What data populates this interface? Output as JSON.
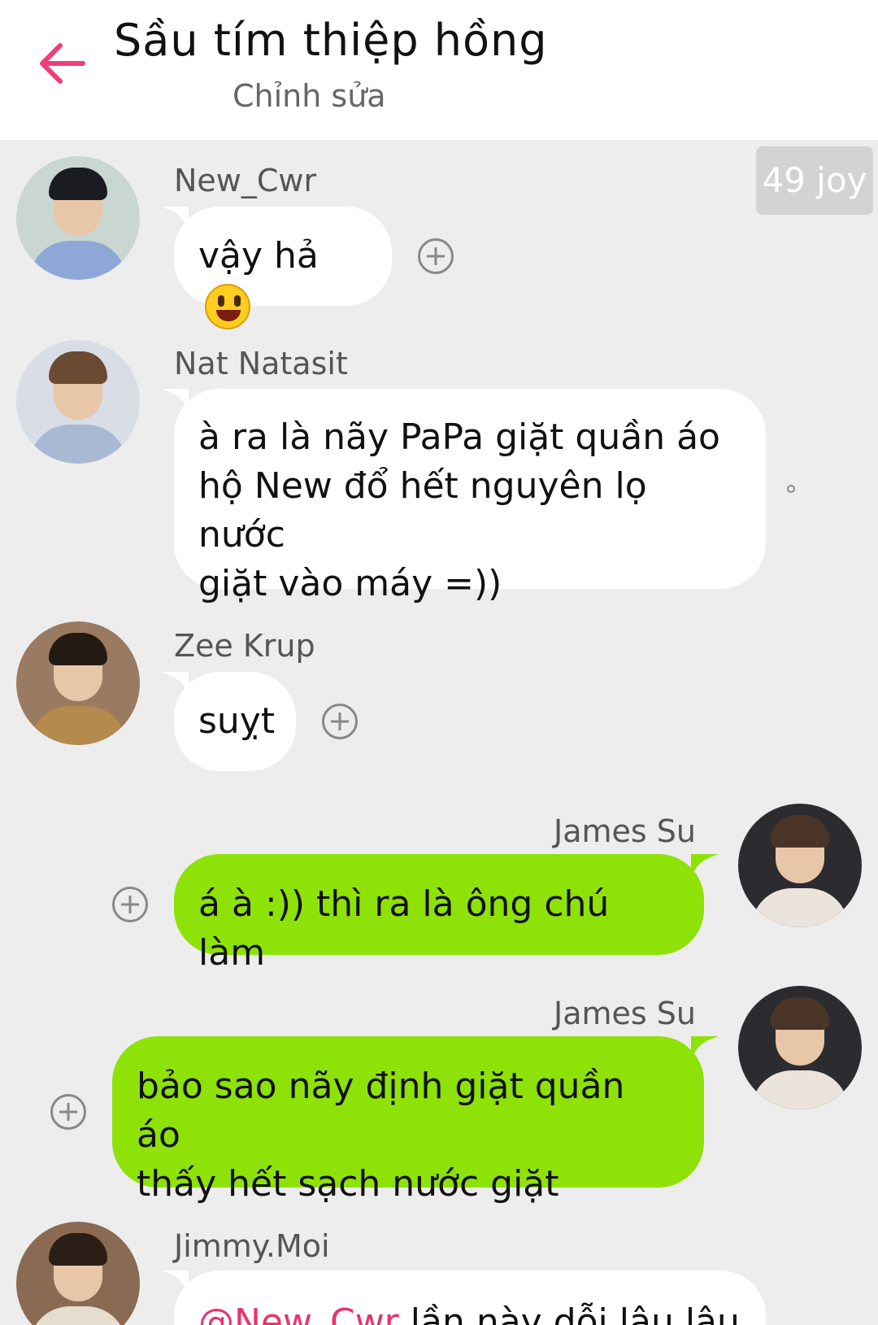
{
  "header": {
    "title": "Sầu tím thiệp hồng",
    "subtitle": "Chỉnh sửa"
  },
  "timer": "49 joy",
  "messages": [
    {
      "sender": "New_Cwr",
      "text": "vậy hả",
      "emoji": "grinning-face-emoji",
      "side": "left"
    },
    {
      "sender": "Nat Natasit",
      "lines": [
        "à ra là nãy PaPa giặt quần áo",
        "hộ New đổ hết nguyên lọ nước",
        "giặt vào máy =))"
      ],
      "side": "left"
    },
    {
      "sender": "Zee Krup",
      "text": "suỵt",
      "side": "left"
    },
    {
      "sender": "James Su",
      "text": "á à :)) thì ra là ông chú làm",
      "side": "right"
    },
    {
      "sender": "James Su",
      "lines": [
        "bảo sao nãy định giặt quần áo",
        "thấy hết sạch nước giặt"
      ],
      "side": "right"
    },
    {
      "sender": "Jimmy.Moi",
      "mention": "@New_Cwr",
      "text": " lần này dỗi lâu lâu",
      "side": "left"
    }
  ],
  "colors": {
    "accent": "#ef3f7a",
    "outgoing_bubble": "#8ee208",
    "incoming_bubble": "#ffffff",
    "background": "#ededed"
  }
}
